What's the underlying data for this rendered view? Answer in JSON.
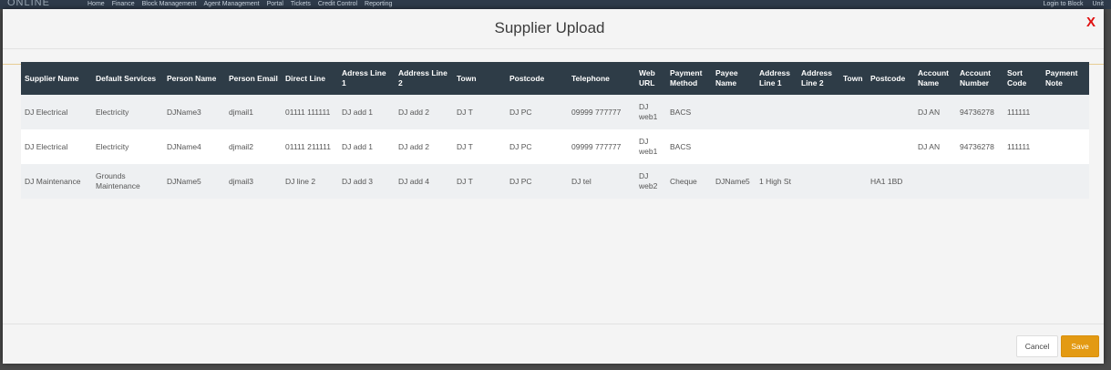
{
  "topnav": {
    "logo": "ONLINE",
    "menu": [
      "Home",
      "Finance",
      "Block Management",
      "Agent Management",
      "Portal",
      "Tickets",
      "Credit Control",
      "Reporting"
    ],
    "right": [
      "Login to Block",
      "Unit"
    ]
  },
  "modal": {
    "title": "Supplier Upload",
    "close_label": "X"
  },
  "table": {
    "columns": [
      "Supplier Name",
      "Default Services",
      "Person Name",
      "Person Email",
      "Direct Line",
      "Adress Line 1",
      "Address Line 2",
      "Town",
      "Postcode",
      "Telephone",
      "Web URL",
      "Payment Method",
      "Payee Name",
      "Address Line 1",
      "Address Line 2",
      "Town",
      "Postcode",
      "Account Name",
      "Account Number",
      "Sort Code",
      "Payment Note"
    ],
    "rows": [
      [
        "DJ Electrical",
        "Electricity",
        "DJName3",
        "djmail1",
        "01111 111111",
        "DJ add 1",
        "DJ add 2",
        "DJ T",
        "DJ PC",
        "09999 777777",
        "DJ web1",
        "BACS",
        "",
        "",
        "",
        "",
        "",
        "DJ AN",
        "94736278",
        "111111",
        ""
      ],
      [
        "DJ Electrical",
        "Electricity",
        "DJName4",
        "djmail2",
        "01111 211111",
        "DJ add 1",
        "DJ add 2",
        "DJ T",
        "DJ PC",
        "09999 777777",
        "DJ web1",
        "BACS",
        "",
        "",
        "",
        "",
        "",
        "DJ AN",
        "94736278",
        "111111",
        ""
      ],
      [
        "DJ Maintenance",
        "Grounds Maintenance",
        "DJName5",
        "djmail3",
        "DJ line 2",
        "DJ add 3",
        "DJ add 4",
        "DJ T",
        "DJ PC",
        "DJ tel",
        "DJ web2",
        "Cheque",
        "DJName5",
        "1 High St",
        "",
        "",
        "HA1 1BD",
        "",
        "",
        "",
        ""
      ]
    ]
  },
  "footer": {
    "cancel_label": "Cancel",
    "save_label": "Save"
  },
  "colors": {
    "header_bg": "#2e3c47",
    "save_bg": "#e39a13",
    "close": "#e01010"
  }
}
